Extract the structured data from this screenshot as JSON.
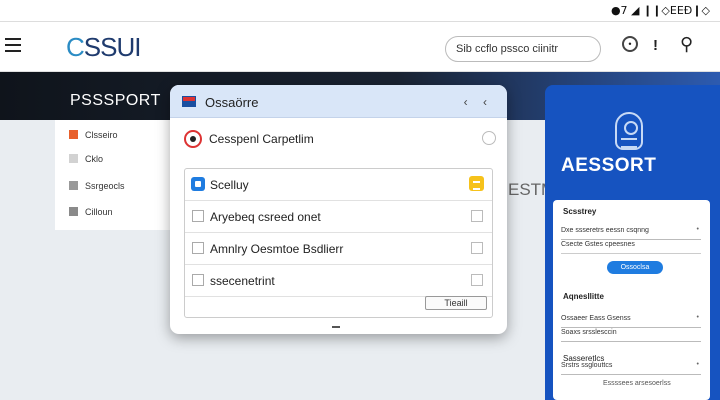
{
  "status": {
    "text": "●7 ◢ ❙❙◇ΕΕĐ❙◇"
  },
  "app": {
    "logo_prefix": "C",
    "logo_rest": "SSUI",
    "search_text": "Sib ccflo pssco ciinitr"
  },
  "page": {
    "title": "PSSSPORT",
    "main_text": "ESTM"
  },
  "sidebar": {
    "items": [
      {
        "label": "Clsseiro",
        "color": "#e8602c"
      },
      {
        "label": "Cklo",
        "color": "#d2d2d2"
      },
      {
        "label": "Ssrgeocls",
        "color": "#999999"
      },
      {
        "label": "Cilloun",
        "color": "#8a8a8a"
      }
    ]
  },
  "modal": {
    "title": "Ossaörre",
    "controls": "‹ ‹",
    "radio_label": "Cesspenl Carpetlim",
    "list": [
      {
        "label": "Scelluy"
      },
      {
        "label": "Aryebeq csreed onet"
      },
      {
        "label": "Amnlry Oesmtoe Bsdlierr"
      },
      {
        "label": "ssecenetrint"
      }
    ],
    "button_label": "Tieaill"
  },
  "card": {
    "title": "AESSORT",
    "section1_label": "Scsstrey",
    "field1": "Dxe ssseretrs eessn csqnng",
    "field2": "Csecte Gstes cpeesnes",
    "button_label": "Ossoclsa",
    "section2_label": "Aqnesllitte",
    "field3": "Ossaeer Eass Gsenss",
    "field4": "Soaxs srsslesccin",
    "section3_label": "Sasseretlcs",
    "field5": "Srstrs ssglouttcs",
    "footer": "Essssees arsesoerlss"
  },
  "colors": {
    "card_blue": "#1653c0",
    "accent": "#1f7ce0",
    "header_gradient_end": "#2d5bb0"
  }
}
